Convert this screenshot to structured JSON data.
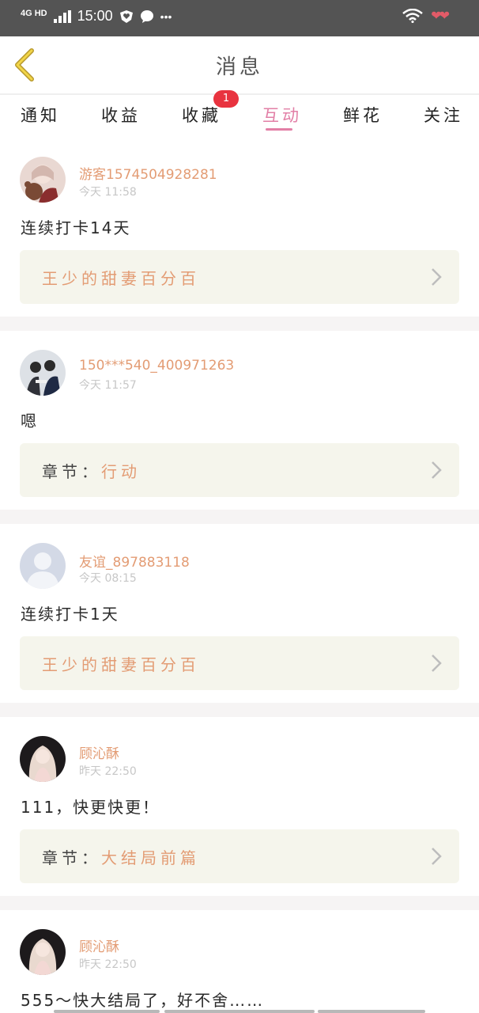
{
  "status_bar": {
    "network": "4G HD",
    "time": "15:00",
    "dots": "•••"
  },
  "header": {
    "title": "消息"
  },
  "tabs": [
    {
      "label": "通知"
    },
    {
      "label": "收益"
    },
    {
      "label": "收藏",
      "badge": "1"
    },
    {
      "label": "互动",
      "active": true
    },
    {
      "label": "鲜花"
    },
    {
      "label": "关注"
    }
  ],
  "messages": [
    {
      "user": "游客1574504928281",
      "time": "今天 11:58",
      "content": "连续打卡14天",
      "ref_prefix": "",
      "ref_value": "王少的甜妻百分百"
    },
    {
      "user": "150***540_400971263",
      "time": "今天 11:57",
      "content": "嗯",
      "ref_prefix": "章节：",
      "ref_value": "行动"
    },
    {
      "user": "友谊_897883118",
      "time": "今天 08:15",
      "content": "连续打卡1天",
      "ref_prefix": "",
      "ref_value": "王少的甜妻百分百"
    },
    {
      "user": "顾沁酥",
      "time": "昨天 22:50",
      "content": "111，快更快更！",
      "ref_prefix": "章节：",
      "ref_value": "大结局前篇"
    },
    {
      "user": "顾沁酥",
      "time": "昨天 22:50",
      "content": "555～快大结局了，好不舍……",
      "ref_prefix": "",
      "ref_value": ""
    }
  ],
  "colors": {
    "accent_pink": "#e27fa6",
    "name_orange": "#e39c74",
    "badge_red": "#e8333f",
    "ref_bg": "#f5f5ec"
  }
}
